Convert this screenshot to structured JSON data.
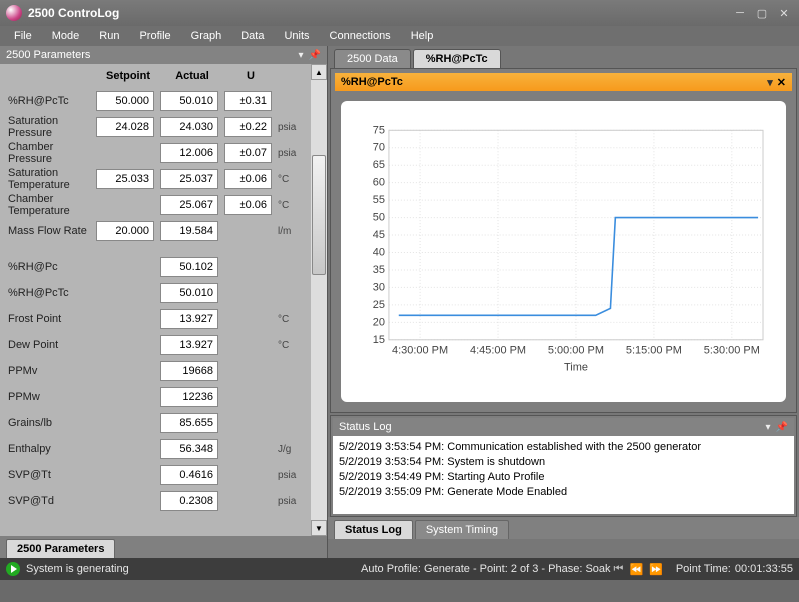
{
  "app": {
    "title": "2500 ControLog"
  },
  "menu": [
    "File",
    "Mode",
    "Run",
    "Profile",
    "Graph",
    "Data",
    "Units",
    "Connections",
    "Help"
  ],
  "left_panel": {
    "title": "2500 Parameters",
    "col_labels": {
      "setpoint": "Setpoint",
      "actual": "Actual",
      "u": "U"
    },
    "rows": [
      {
        "label": "%RH@PcTc",
        "setpoint": "50.000",
        "actual": "50.010",
        "u": "±0.31",
        "unit": ""
      },
      {
        "label": "Saturation Pressure",
        "setpoint": "24.028",
        "actual": "24.030",
        "u": "±0.22",
        "unit": "psia"
      },
      {
        "label": "Chamber Pressure",
        "setpoint": null,
        "actual": "12.006",
        "u": "±0.07",
        "unit": "psia"
      },
      {
        "label": "Saturation Temperature",
        "setpoint": "25.033",
        "actual": "25.037",
        "u": "±0.06",
        "unit": "°C"
      },
      {
        "label": "Chamber Temperature",
        "setpoint": null,
        "actual": "25.067",
        "u": "±0.06",
        "unit": "°C"
      },
      {
        "label": "Mass Flow Rate",
        "setpoint": "20.000",
        "actual": "19.584",
        "u": null,
        "unit": "l/m"
      },
      {
        "label": "%RH@Pc",
        "setpoint": null,
        "actual": "50.102",
        "u": null,
        "unit": ""
      },
      {
        "label": "%RH@PcTc",
        "setpoint": null,
        "actual": "50.010",
        "u": null,
        "unit": ""
      },
      {
        "label": "Frost Point",
        "setpoint": null,
        "actual": "13.927",
        "u": null,
        "unit": "°C"
      },
      {
        "label": "Dew Point",
        "setpoint": null,
        "actual": "13.927",
        "u": null,
        "unit": "°C"
      },
      {
        "label": "PPMv",
        "setpoint": null,
        "actual": "19668",
        "u": null,
        "unit": ""
      },
      {
        "label": "PPMw",
        "setpoint": null,
        "actual": "12236",
        "u": null,
        "unit": ""
      },
      {
        "label": "Grains/lb",
        "setpoint": null,
        "actual": "85.655",
        "u": null,
        "unit": ""
      },
      {
        "label": "Enthalpy",
        "setpoint": null,
        "actual": "56.348",
        "u": null,
        "unit": "J/g"
      },
      {
        "label": "SVP@Tt",
        "setpoint": null,
        "actual": "0.4616",
        "u": null,
        "unit": "psia"
      },
      {
        "label": "SVP@Td",
        "setpoint": null,
        "actual": "0.2308",
        "u": null,
        "unit": "psia"
      }
    ],
    "bottom_tab": "2500 Parameters"
  },
  "right_tabs": {
    "items": [
      "2500 Data",
      "%RH@PcTc"
    ],
    "active": 1
  },
  "chart_panel": {
    "title": "%RH@PcTc"
  },
  "chart_data": {
    "type": "line",
    "title": "%RH@PcTc",
    "xlabel": "Time",
    "ylabel": "",
    "ylim": [
      15,
      75
    ],
    "y_ticks": [
      15,
      20,
      25,
      30,
      35,
      40,
      45,
      50,
      55,
      60,
      65,
      70,
      75
    ],
    "x_tick_labels": [
      "4:30:00 PM",
      "4:45:00 PM",
      "5:00:00 PM",
      "5:15:00 PM",
      "5:30:00 PM"
    ],
    "series": [
      {
        "name": "%RH@PcTc",
        "color": "#3a8dde",
        "x": [
          "4:24:00 PM",
          "4:30:00 PM",
          "4:45:00 PM",
          "5:00:00 PM",
          "5:04:00 PM",
          "5:07:00 PM",
          "5:08:00 PM",
          "5:15:00 PM",
          "5:30:00 PM",
          "5:37:00 PM"
        ],
        "y": [
          22,
          22,
          22,
          22,
          22,
          24,
          50,
          50,
          50,
          50
        ]
      }
    ]
  },
  "status_log": {
    "title": "Status Log",
    "entries": [
      {
        "ts": "5/2/2019 3:53:54 PM:",
        "msg": "Communication established with the 2500 generator"
      },
      {
        "ts": "5/2/2019 3:53:54 PM:",
        "msg": "System is shutdown"
      },
      {
        "ts": "5/2/2019 3:54:49 PM:",
        "msg": "Starting Auto Profile"
      },
      {
        "ts": "5/2/2019 3:55:09 PM:",
        "msg": "Generate Mode Enabled"
      }
    ]
  },
  "bottom_tabs": {
    "items": [
      "Status Log",
      "System Timing"
    ],
    "active": 0
  },
  "statusbar": {
    "left": "System is generating",
    "center": "Auto Profile: Generate - Point: 2 of 3 - Phase: Soak",
    "right_label": "Point Time:",
    "right_value": "00:01:33:55"
  }
}
